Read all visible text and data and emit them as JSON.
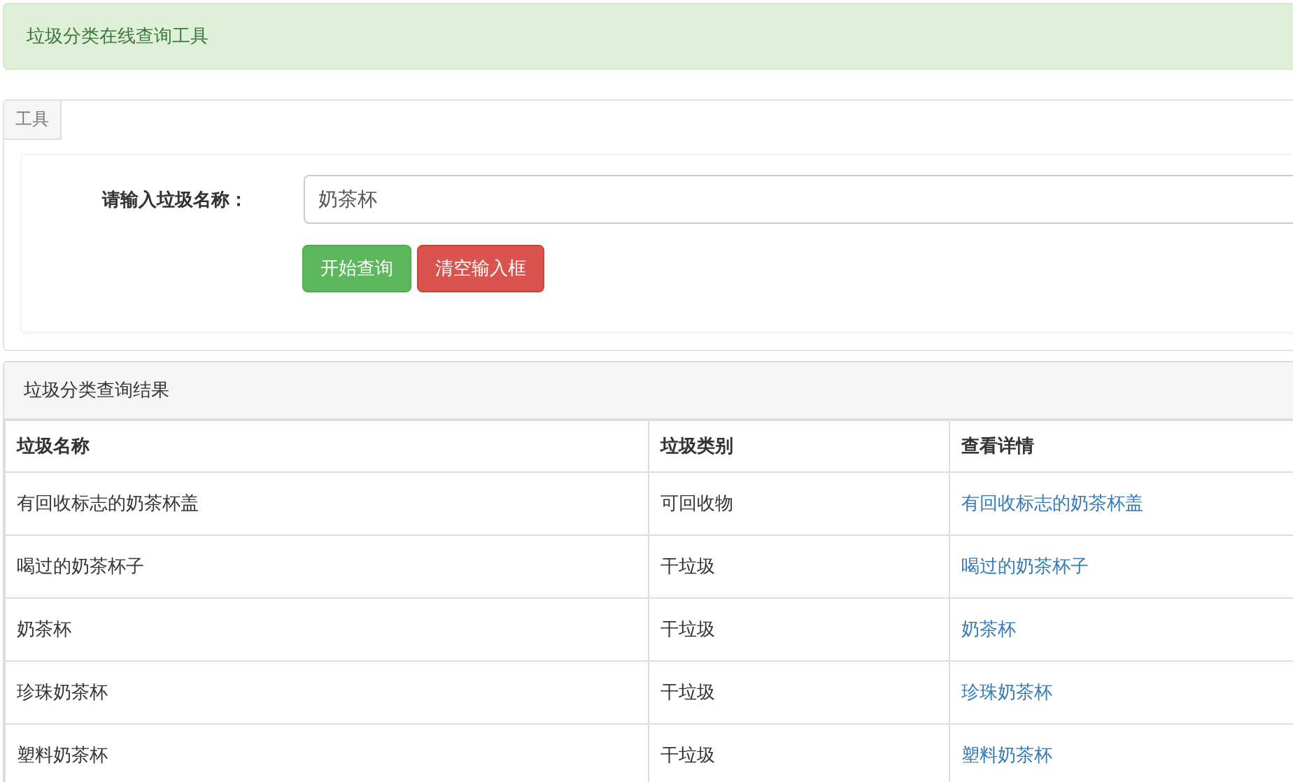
{
  "alert": {
    "text": "垃圾分类在线查询工具"
  },
  "tool_panel": {
    "legend": "工具",
    "label": "请输入垃圾名称：",
    "input": {
      "value": "奶茶杯"
    },
    "buttons": [
      {
        "label": "开始查询",
        "kind": "success"
      },
      {
        "label": "清空输入框",
        "kind": "danger"
      }
    ]
  },
  "results": {
    "title": "垃圾分类查询结果",
    "columns": [
      "垃圾名称",
      "垃圾类别",
      "查看详情"
    ],
    "rows": [
      {
        "name": "有回收标志的奶茶杯盖",
        "category": "可回收物",
        "detail": "有回收标志的奶茶杯盖"
      },
      {
        "name": "喝过的奶茶杯子",
        "category": "干垃圾",
        "detail": "喝过的奶茶杯子"
      },
      {
        "name": "奶茶杯",
        "category": "干垃圾",
        "detail": "奶茶杯"
      },
      {
        "name": "珍珠奶茶杯",
        "category": "干垃圾",
        "detail": "珍珠奶茶杯"
      },
      {
        "name": "塑料奶茶杯",
        "category": "干垃圾",
        "detail": "塑料奶茶杯"
      }
    ]
  }
}
